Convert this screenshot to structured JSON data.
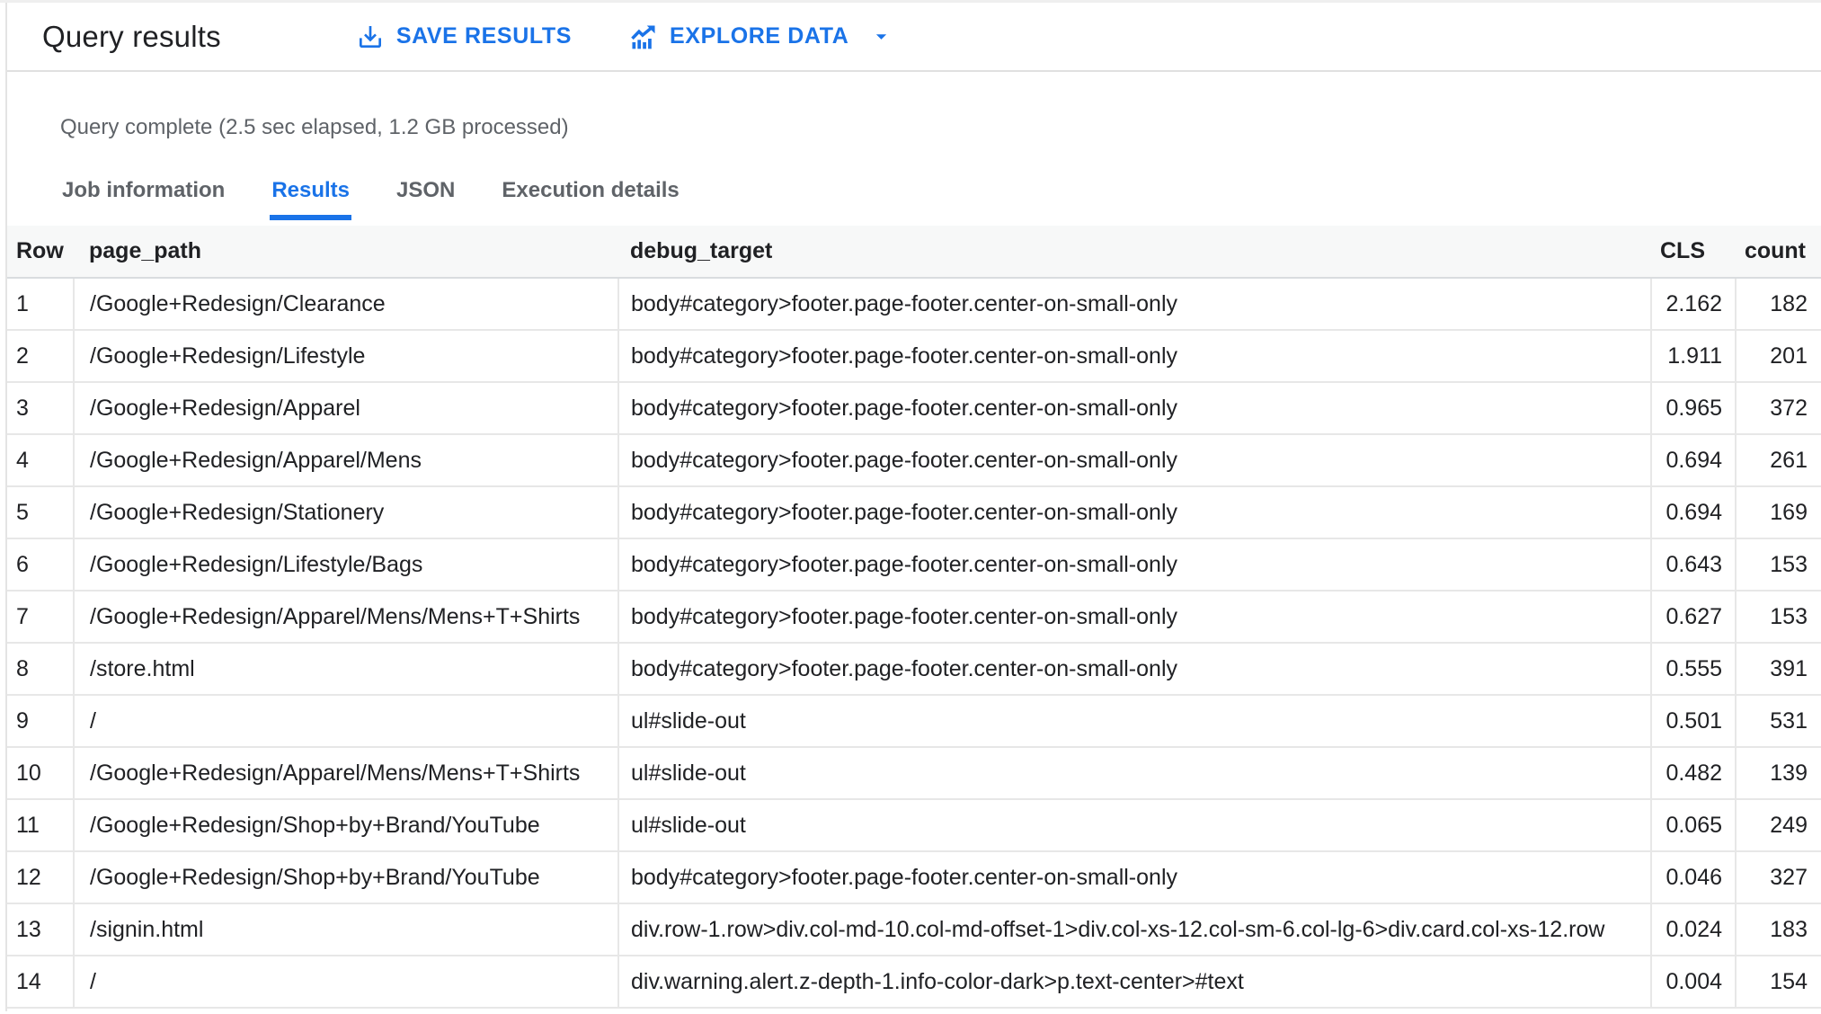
{
  "header": {
    "title": "Query results",
    "save_results_label": "SAVE RESULTS",
    "explore_data_label": "EXPLORE DATA"
  },
  "status_text": "Query complete (2.5 sec elapsed, 1.2 GB processed)",
  "tabs": [
    {
      "label": "Job information",
      "active": false
    },
    {
      "label": "Results",
      "active": true
    },
    {
      "label": "JSON",
      "active": false
    },
    {
      "label": "Execution details",
      "active": false
    }
  ],
  "icons": {
    "save": "download-icon",
    "explore": "chart-trend-icon",
    "dropdown": "arrow-drop-down-icon"
  },
  "colors": {
    "accent_blue": "#1a73e8",
    "text_dark": "#202124",
    "text_gray": "#5f6368",
    "table_header_bg": "#f7f8f8",
    "border_gray": "#e7e7e7"
  },
  "table": {
    "columns": [
      {
        "key": "row",
        "label": "Row"
      },
      {
        "key": "page_path",
        "label": "page_path"
      },
      {
        "key": "debug_target",
        "label": "debug_target"
      },
      {
        "key": "cls",
        "label": "CLS"
      },
      {
        "key": "count",
        "label": "count"
      }
    ],
    "rows": [
      {
        "row": 1,
        "page_path": "/Google+Redesign/Clearance",
        "debug_target": "body#category>footer.page-footer.center-on-small-only",
        "cls": "2.162",
        "count": 182
      },
      {
        "row": 2,
        "page_path": "/Google+Redesign/Lifestyle",
        "debug_target": "body#category>footer.page-footer.center-on-small-only",
        "cls": "1.911",
        "count": 201
      },
      {
        "row": 3,
        "page_path": "/Google+Redesign/Apparel",
        "debug_target": "body#category>footer.page-footer.center-on-small-only",
        "cls": "0.965",
        "count": 372
      },
      {
        "row": 4,
        "page_path": "/Google+Redesign/Apparel/Mens",
        "debug_target": "body#category>footer.page-footer.center-on-small-only",
        "cls": "0.694",
        "count": 261
      },
      {
        "row": 5,
        "page_path": "/Google+Redesign/Stationery",
        "debug_target": "body#category>footer.page-footer.center-on-small-only",
        "cls": "0.694",
        "count": 169
      },
      {
        "row": 6,
        "page_path": "/Google+Redesign/Lifestyle/Bags",
        "debug_target": "body#category>footer.page-footer.center-on-small-only",
        "cls": "0.643",
        "count": 153
      },
      {
        "row": 7,
        "page_path": "/Google+Redesign/Apparel/Mens/Mens+T+Shirts",
        "debug_target": "body#category>footer.page-footer.center-on-small-only",
        "cls": "0.627",
        "count": 153
      },
      {
        "row": 8,
        "page_path": "/store.html",
        "debug_target": "body#category>footer.page-footer.center-on-small-only",
        "cls": "0.555",
        "count": 391
      },
      {
        "row": 9,
        "page_path": "/",
        "debug_target": "ul#slide-out",
        "cls": "0.501",
        "count": 531
      },
      {
        "row": 10,
        "page_path": "/Google+Redesign/Apparel/Mens/Mens+T+Shirts",
        "debug_target": "ul#slide-out",
        "cls": "0.482",
        "count": 139
      },
      {
        "row": 11,
        "page_path": "/Google+Redesign/Shop+by+Brand/YouTube",
        "debug_target": "ul#slide-out",
        "cls": "0.065",
        "count": 249
      },
      {
        "row": 12,
        "page_path": "/Google+Redesign/Shop+by+Brand/YouTube",
        "debug_target": "body#category>footer.page-footer.center-on-small-only",
        "cls": "0.046",
        "count": 327
      },
      {
        "row": 13,
        "page_path": "/signin.html",
        "debug_target": "div.row-1.row>div.col-md-10.col-md-offset-1>div.col-xs-12.col-sm-6.col-lg-6>div.card.col-xs-12.row",
        "cls": "0.024",
        "count": 183
      },
      {
        "row": 14,
        "page_path": "/",
        "debug_target": "div.warning.alert.z-depth-1.info-color-dark>p.text-center>#text",
        "cls": "0.004",
        "count": 154
      }
    ]
  }
}
